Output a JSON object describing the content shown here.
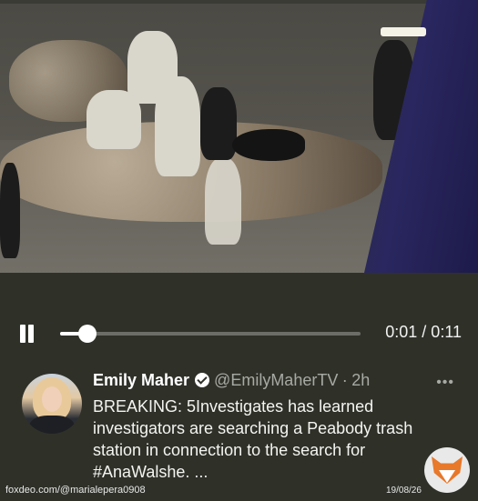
{
  "video": {
    "scene": "surveillance footage",
    "elapsed": "0:01",
    "duration": "0:11",
    "time_display": "0:01 / 0:11",
    "progress": 0.09
  },
  "tweet": {
    "author_name": "Emily Maher",
    "handle": "@EmilyMaherTV",
    "separator": "·",
    "age": "2h",
    "more": "•••",
    "text_lines": [
      "BREAKING: 5Investigates has learned",
      "investigators are searching a Peabody trash",
      "station in connection to the search for"
    ],
    "hashtag": "#AnaWalshe",
    "ellipsis": ". ..."
  },
  "footer": {
    "watermark": "foxdeo.com/@marialepera0908",
    "date": "19/08/26"
  },
  "icons": {
    "play_state": "pause-icon",
    "verified": "verified-badge-icon",
    "brand": "fox-logo-icon"
  },
  "colors": {
    "background": "#2f3129",
    "text": "#ffffff",
    "muted": "#a7a9a3"
  }
}
